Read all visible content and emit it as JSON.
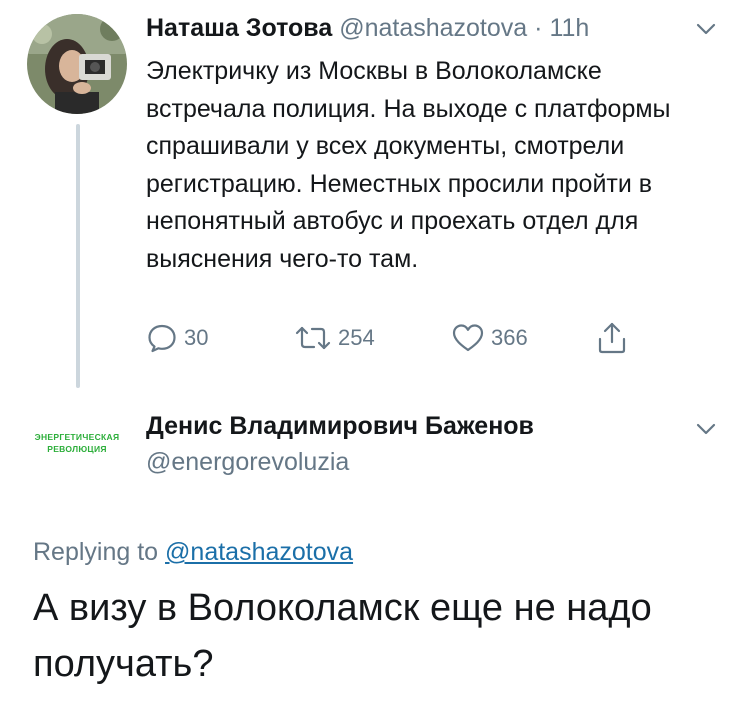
{
  "tweet": {
    "author_name": "Наташа Зотова",
    "author_handle": "@natashazotova",
    "separator": "·",
    "time": "11h",
    "text": "Электричку из Москвы в Волоколамске встречала полиция. На выходе с платформы спрашивали у всех документы, смотрели регистрацию. Неместных просили пройти в непонятный автобус и проехать отдел для выяснения чего-то там.",
    "actions": {
      "reply_count": "30",
      "retweet_count": "254",
      "like_count": "366"
    },
    "icons": {
      "reply": "reply-icon",
      "retweet": "retweet-icon",
      "like": "heart-icon",
      "share": "share-icon",
      "menu": "chevron-down-icon"
    }
  },
  "reply": {
    "avatar_text_line1": "ЭНЕРГЕТИЧЕСКАЯ",
    "avatar_text_line2": "РЕВОЛЮЦИЯ",
    "author_name": "Денис Владимирович Баженов",
    "author_handle": "@energorevoluzia",
    "replying_prefix": "Replying to",
    "replying_to": "@natashazotova",
    "text": "А визу в Волоколамск еще не надо получать?"
  },
  "colors": {
    "primary_text": "#14171a",
    "secondary_text": "#657786",
    "link": "#1b6fa8",
    "thread_line": "#ccd6dd",
    "avatar_brand_green": "#2cae3a"
  }
}
